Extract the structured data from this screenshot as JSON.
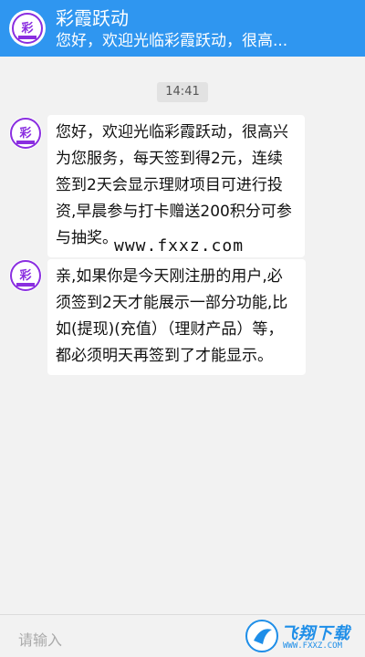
{
  "header": {
    "title": "彩霞跃动",
    "subtitle": "您好，欢迎光临彩霞跃动，很高..."
  },
  "chat": {
    "timestamp": "14:41",
    "messages": [
      {
        "sender": "bot",
        "text": "您好，欢迎光临彩霞跃动，很高兴为您服务，每天签到得2元，连续签到2天会显示理财项目可进行投资,早晨参与打卡赠送200积分可参与抽奖。"
      },
      {
        "sender": "bot",
        "text": "亲,如果你是今天刚注册的用户,必须签到2天才能展示一部分功能,比如(提现)(充值）（理财产品）等，都必须明天再签到了才能显示。"
      }
    ]
  },
  "watermark_text": "www.fxxz.com",
  "input": {
    "placeholder": "请输入"
  },
  "corner_watermark": {
    "title": "飞翔下载",
    "url": "WWW.FXXZ.COM"
  },
  "avatar_label": "彩",
  "colors": {
    "header_bg": "#2f96f0",
    "accent": "#8a2ee0"
  }
}
